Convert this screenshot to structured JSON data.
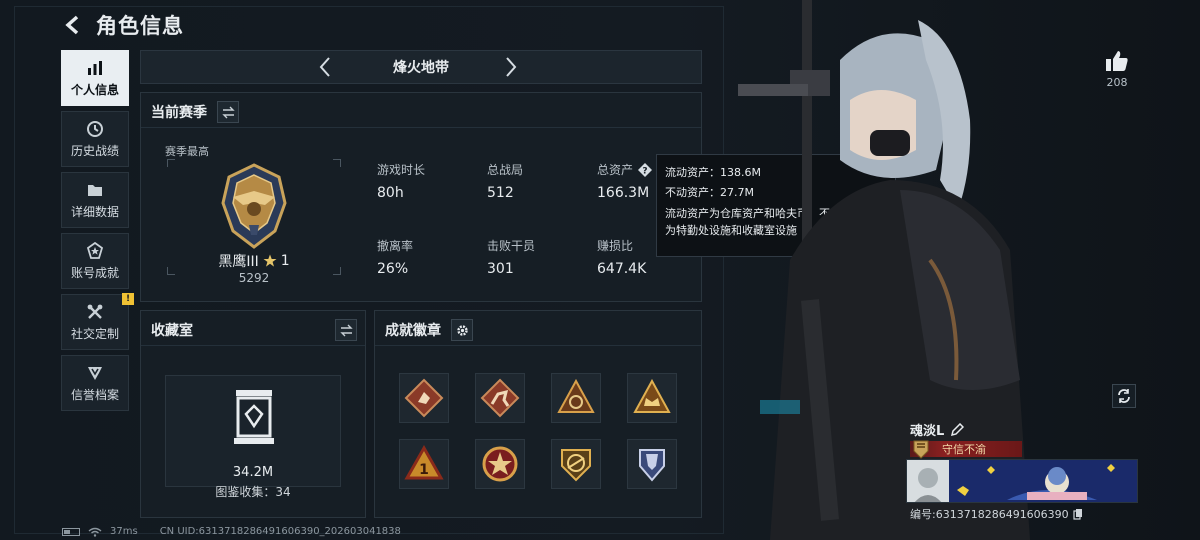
{
  "header": {
    "title": "角色信息"
  },
  "sidebar": {
    "items": [
      {
        "label": "个人信息",
        "icon": "bar-chart-icon",
        "active": true
      },
      {
        "label": "历史战绩",
        "icon": "clock-icon"
      },
      {
        "label": "详细数据",
        "icon": "folder-icon"
      },
      {
        "label": "账号成就",
        "icon": "star-medal-icon"
      },
      {
        "label": "社交定制",
        "icon": "tools-icon",
        "badge": "!"
      },
      {
        "label": "信誉档案",
        "icon": "shield-icon"
      }
    ]
  },
  "map_selector": {
    "current": "烽火地带"
  },
  "season": {
    "title": "当前赛季",
    "subtitle": "赛季最高",
    "rank_name": "黑鹰III",
    "rank_stars": "1",
    "rank_score": "5292",
    "stats": [
      {
        "label": "游戏时长",
        "value": "80h"
      },
      {
        "label": "总战局",
        "value": "512"
      },
      {
        "label": "总资产",
        "value": "166.3M"
      },
      {
        "label": "撤离率",
        "value": "26%"
      },
      {
        "label": "击败干员",
        "value": "301"
      },
      {
        "label": "赚损比",
        "value": "647.4K"
      }
    ]
  },
  "tooltip": {
    "liquid": "流动资产：138.6M",
    "fixed": "不动资产：27.7M",
    "desc_line1": "流动资产为仓库资产和哈夫币，不动资产",
    "desc_line2": "为特勤处设施和收藏室设施"
  },
  "collection": {
    "title": "收藏室",
    "value": "34.2M",
    "count": "图鉴收集：34"
  },
  "achievements": {
    "title": "成就徽章",
    "badges": [
      "badge-1",
      "badge-2",
      "badge-3",
      "badge-4",
      "badge-5",
      "badge-6",
      "badge-7",
      "badge-8"
    ]
  },
  "status_bar": {
    "ping": "37ms",
    "uid_line": "CN UID:6313718286491606390_202603041838"
  },
  "likes": {
    "count": "208"
  },
  "player": {
    "name": "魂淡L",
    "title": "守信不渝",
    "id_line": "编号:6313718286491606390"
  },
  "colors": {
    "accent_gold": "#c9a35a",
    "title_red": "#8a2020",
    "panel_bg": "#161e25"
  }
}
